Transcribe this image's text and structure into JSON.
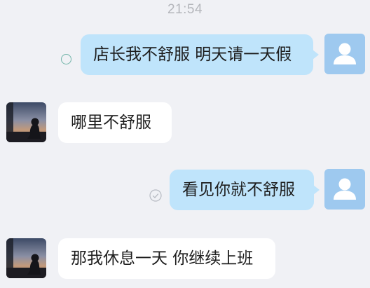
{
  "chat": {
    "timestamp": "21:54",
    "messages": [
      {
        "direction": "outgoing",
        "text": "店长我不舒服 明天请一天假",
        "status": "sending-circle-icon"
      },
      {
        "direction": "incoming",
        "text": "哪里不舒服"
      },
      {
        "direction": "outgoing",
        "text": "看见你就不舒服",
        "status": "read-check-icon"
      },
      {
        "direction": "incoming",
        "text": "那我休息一天 你继续上班"
      }
    ]
  },
  "colors": {
    "background": "#f0f1f5",
    "outgoing_bubble": "#bfe4fb",
    "incoming_bubble": "#ffffff",
    "default_avatar": "#9ec9ef",
    "timestamp_text": "#b4b6bb"
  }
}
